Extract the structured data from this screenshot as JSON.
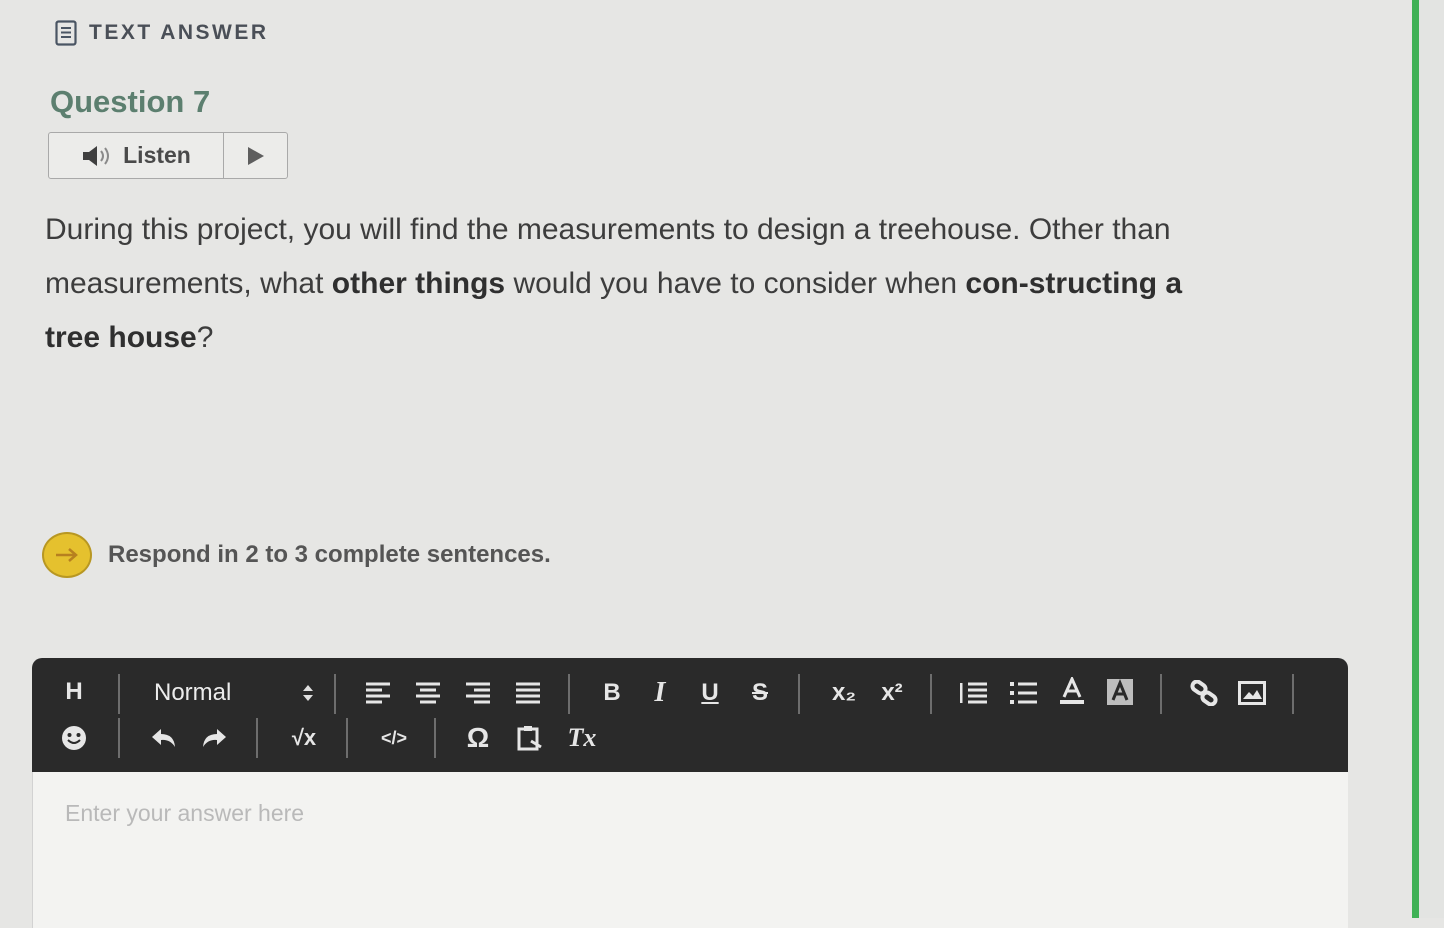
{
  "section": {
    "title": "TEXT ANSWER",
    "icon": "document-icon"
  },
  "question": {
    "title": "Question 7",
    "listen_label": "Listen",
    "prompt": {
      "parts": [
        {
          "text": "During this project, you will find the measurements to design a treehouse. Other than measurements, what ",
          "bold": false
        },
        {
          "text": "other things",
          "bold": true
        },
        {
          "text": " would you have to consider when ",
          "bold": false
        },
        {
          "text": "con-structing a tree house",
          "bold": true
        },
        {
          "text": "?",
          "bold": false
        }
      ]
    }
  },
  "instruction": {
    "text": "Respond in 2 to 3 complete sentences.",
    "icon": "arrow-right-icon"
  },
  "editor": {
    "heading_label": "H",
    "format_select_value": "Normal",
    "placeholder": "Enter your answer here",
    "buttons": {
      "bold": "B",
      "italic": "I",
      "underline": "U",
      "strike": "S",
      "subscript": "x₂",
      "superscript": "x²",
      "formula": "√x",
      "code": "</>",
      "special_char": "Ω",
      "clear_format": "Tx"
    }
  },
  "colors": {
    "background": "#e6e6e4",
    "accent_green": "#3fb155",
    "question_title": "#5c7f6f",
    "toolbar_bg": "#2a2a2a",
    "instruction_icon": "#e5c12e"
  }
}
